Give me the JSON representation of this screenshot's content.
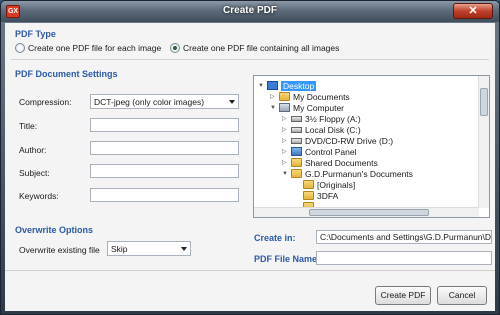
{
  "window": {
    "title": "Create PDF",
    "app_icon_text": "GX",
    "close_label": "✕"
  },
  "pdf_type": {
    "heading": "PDF Type",
    "option_each": "Create one PDF file for each image",
    "option_all": "Create one PDF file containing all images",
    "selected": "all"
  },
  "doc_settings": {
    "heading": "PDF Document Settings",
    "compression_label": "Compression:",
    "compression_value": "DCT-jpeg (only color images)",
    "title_label": "Title:",
    "author_label": "Author:",
    "subject_label": "Subject:",
    "keywords_label": "Keywords:",
    "title_value": "",
    "author_value": "",
    "subject_value": "",
    "keywords_value": ""
  },
  "overwrite": {
    "heading": "Overwrite Options",
    "label": "Overwrite existing file",
    "value": "Skip"
  },
  "tree": {
    "items": [
      {
        "label": "Desktop",
        "icon": "desktop-icon",
        "exp": "▼"
      },
      {
        "label": "My Documents",
        "icon": "folder-icon",
        "exp": "▷"
      },
      {
        "label": "My Computer",
        "icon": "computer-icon",
        "exp": "▼"
      },
      {
        "label": "3½ Floppy (A:)",
        "icon": "floppy-icon",
        "exp": "▷"
      },
      {
        "label": "Local Disk (C:)",
        "icon": "drive-icon",
        "exp": "▷"
      },
      {
        "label": "DVD/CD-RW Drive (D:)",
        "icon": "drive-icon",
        "exp": "▷"
      },
      {
        "label": "Control Panel",
        "icon": "control-panel-icon",
        "exp": "▷"
      },
      {
        "label": "Shared Documents",
        "icon": "folder-icon",
        "exp": "▷"
      },
      {
        "label": "G.D.Purmanun's Documents",
        "icon": "folder-icon",
        "exp": "▼"
      },
      {
        "label": "[Originals]",
        "icon": "folder-icon",
        "exp": ""
      },
      {
        "label": "3DFA",
        "icon": "folder-icon",
        "exp": ""
      },
      {
        "label": "",
        "icon": "folder-icon",
        "exp": ""
      }
    ]
  },
  "output": {
    "create_in_label": "Create in:",
    "create_in_value": "C:\\Documents and Settings\\G.D.Purmanun\\De",
    "filename_label": "PDF File Name:",
    "filename_value": ""
  },
  "buttons": {
    "create": "Create PDF",
    "cancel": "Cancel"
  },
  "colors": {
    "accent_heading": "#2b5aa8",
    "selection": "#3399ff"
  }
}
